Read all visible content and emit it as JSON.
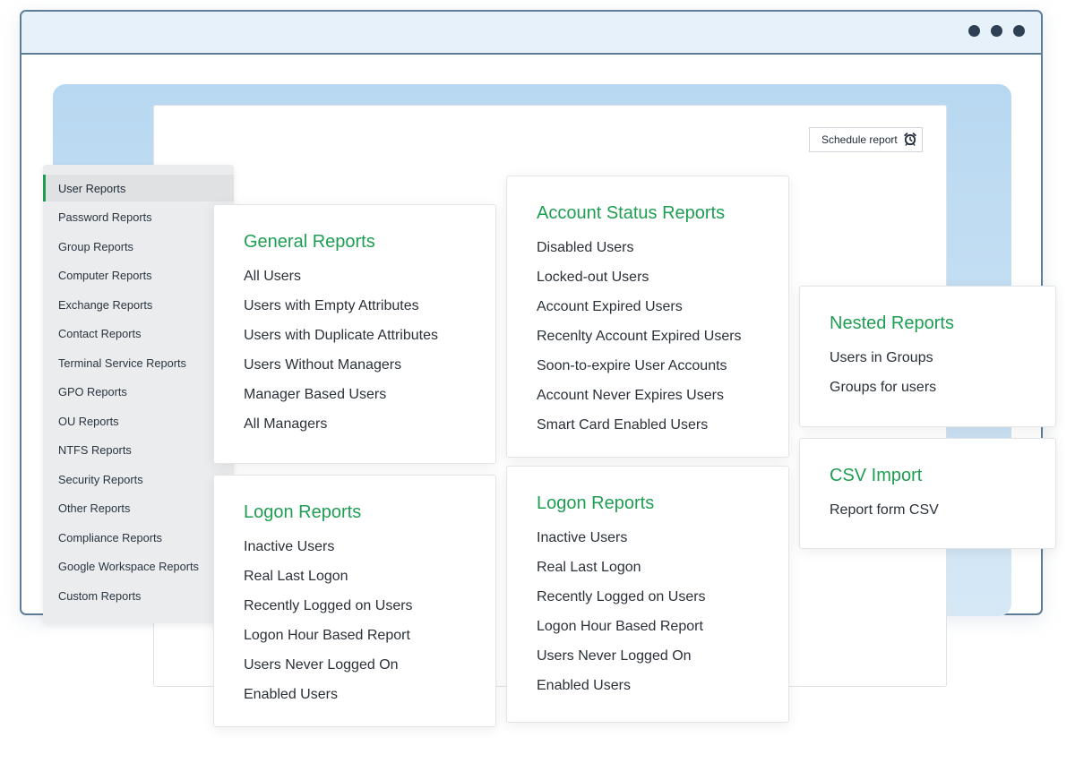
{
  "window": {
    "controls": [
      "dot",
      "dot",
      "dot"
    ]
  },
  "toolbar": {
    "schedule_label": "Schedule report",
    "schedule_icon": "alarm-clock-icon"
  },
  "sidebar": {
    "items": [
      {
        "label": "User Reports",
        "active": true
      },
      {
        "label": "Password Reports"
      },
      {
        "label": "Group Reports"
      },
      {
        "label": "Computer Reports"
      },
      {
        "label": "Exchange Reports"
      },
      {
        "label": "Contact Reports"
      },
      {
        "label": "Terminal Service Reports"
      },
      {
        "label": "GPO Reports"
      },
      {
        "label": "OU Reports"
      },
      {
        "label": "NTFS Reports"
      },
      {
        "label": "Security Reports"
      },
      {
        "label": "Other Reports"
      },
      {
        "label": "Compliance Reports"
      },
      {
        "label": "Google Workspace Reports"
      },
      {
        "label": "Custom Reports"
      }
    ]
  },
  "cards": {
    "general": {
      "title": "General Reports",
      "items": [
        "All Users",
        "Users with Empty Attributes",
        "Users with Duplicate Attributes",
        "Users Without Managers",
        "Manager Based Users",
        "All Managers"
      ]
    },
    "account_status": {
      "title": "Account Status Reports",
      "items": [
        "Disabled Users",
        "Locked-out Users",
        "Account Expired Users",
        "Recenlty Account Expired Users",
        "Soon-to-expire User Accounts",
        "Account Never Expires Users",
        "Smart Card Enabled Users"
      ]
    },
    "nested": {
      "title": "Nested Reports",
      "items": [
        "Users in Groups",
        "Groups for users"
      ]
    },
    "csv": {
      "title": "CSV Import",
      "items": [
        "Report form CSV"
      ]
    },
    "logon_left": {
      "title": "Logon Reports",
      "items": [
        "Inactive Users",
        "Real Last Logon",
        "Recently Logged on Users",
        "Logon Hour Based Report",
        "Users Never Logged On",
        "Enabled Users"
      ]
    },
    "logon_right": {
      "title": "Logon Reports",
      "items": [
        "Inactive Users",
        "Real Last Logon",
        "Recently Logged on Users",
        "Logon Hour Based Report",
        "Users Never Logged On",
        "Enabled Users"
      ]
    }
  },
  "colors": {
    "accent": "#1e9e52",
    "window_border": "#5d7c98",
    "titlebar": "#e6f1fa",
    "stage": "#c6e0f4"
  }
}
